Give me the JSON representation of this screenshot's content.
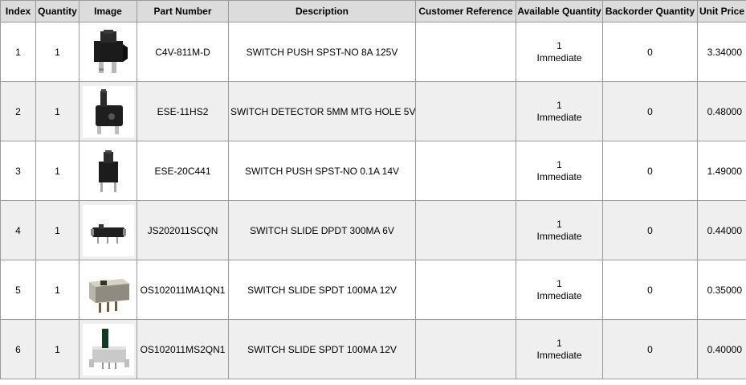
{
  "headers": {
    "index": "Index",
    "quantity": "Quantity",
    "image": "Image",
    "part_number": "Part Number",
    "description": "Description",
    "customer_reference": "Customer Reference",
    "available_quantity": "Available Quantity",
    "backorder_quantity": "Backorder Quantity",
    "unit_price": "Unit Price"
  },
  "rows": [
    {
      "index": "1",
      "quantity": "1",
      "image_icon": "push-switch-black-icon",
      "part_number": "C4V-811M-D",
      "description": "SWITCH PUSH SPST-NO 8A 125V",
      "customer_reference": "",
      "available_qty": "1",
      "available_status": "Immediate",
      "backorder": "0",
      "price": "3.34000"
    },
    {
      "index": "2",
      "quantity": "1",
      "image_icon": "detector-switch-icon",
      "part_number": "ESE-11HS2",
      "description": "SWITCH DETECTOR 5MM MTG HOLE 5V",
      "customer_reference": "",
      "available_qty": "1",
      "available_status": "Immediate",
      "backorder": "0",
      "price": "0.48000"
    },
    {
      "index": "3",
      "quantity": "1",
      "image_icon": "push-switch-small-icon",
      "part_number": "ESE-20C441",
      "description": "SWITCH PUSH SPST-NO 0.1A 14V",
      "customer_reference": "",
      "available_qty": "1",
      "available_status": "Immediate",
      "backorder": "0",
      "price": "1.49000"
    },
    {
      "index": "4",
      "quantity": "1",
      "image_icon": "slide-switch-black-icon",
      "part_number": "JS202011SCQN",
      "description": "SWITCH SLIDE DPDT 300MA 6V",
      "customer_reference": "",
      "available_qty": "1",
      "available_status": "Immediate",
      "backorder": "0",
      "price": "0.44000"
    },
    {
      "index": "5",
      "quantity": "1",
      "image_icon": "slide-switch-metal-icon",
      "part_number": "OS102011MA1QN1",
      "description": "SWITCH SLIDE SPDT 100MA 12V",
      "customer_reference": "",
      "available_qty": "1",
      "available_status": "Immediate",
      "backorder": "0",
      "price": "0.35000"
    },
    {
      "index": "6",
      "quantity": "1",
      "image_icon": "slide-switch-green-icon",
      "part_number": "OS102011MS2QN1",
      "description": "SWITCH SLIDE SPDT 100MA 12V",
      "customer_reference": "",
      "available_qty": "1",
      "available_status": "Immediate",
      "backorder": "0",
      "price": "0.40000"
    }
  ]
}
